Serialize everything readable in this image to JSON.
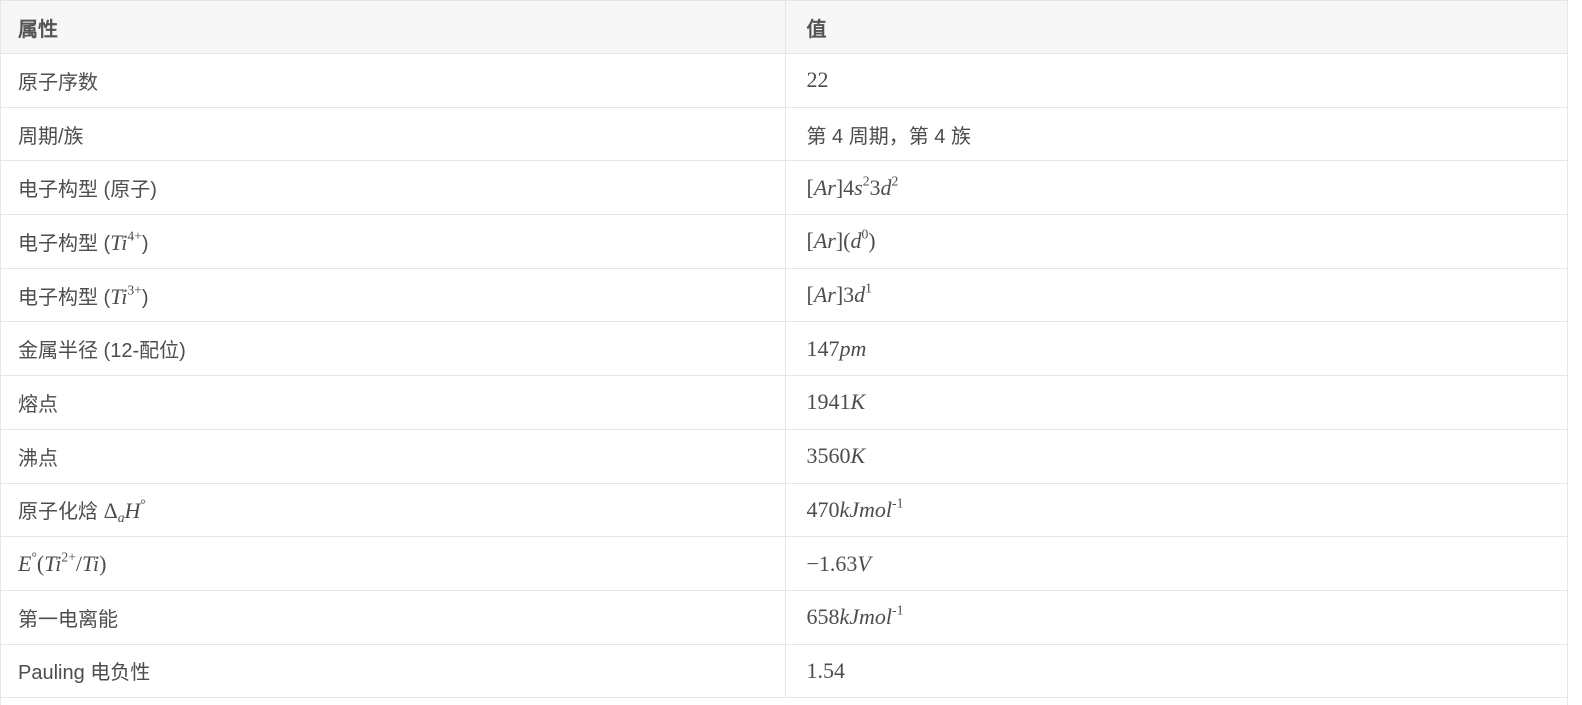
{
  "header": {
    "col_property": "属性",
    "col_value": "值"
  },
  "rows": [
    {
      "property": "原子序数",
      "value": "22"
    },
    {
      "property": "周期/族",
      "value": "第 4 周期，第 4 族"
    },
    {
      "property": "电子构型 (原子)",
      "value_parts": {
        "a": "[",
        "b": "Ar",
        "c": "]4",
        "d": "s",
        "e": "2",
        "f": "3",
        "g": "d",
        "h": "2"
      }
    },
    {
      "property_parts": {
        "prefix": "电子构型 (",
        "ti": "Ti",
        "sup": "4+",
        "suffix": ")"
      },
      "value_parts": {
        "a": "[",
        "b": "Ar",
        "c": "](",
        "d": "d",
        "e": "0",
        "f": ")"
      }
    },
    {
      "property_parts": {
        "prefix": "电子构型 (",
        "ti": "Ti",
        "sup": "3+",
        "suffix": ")"
      },
      "value_parts": {
        "a": "[",
        "b": "Ar",
        "c": "]3",
        "d": "d",
        "e": "1"
      }
    },
    {
      "property": "金属半径 (12-配位)",
      "value_parts": {
        "num": "147",
        "unit": "pm"
      }
    },
    {
      "property": "熔点",
      "value_parts": {
        "num": "1941",
        "unit": "K"
      }
    },
    {
      "property": "沸点",
      "value_parts": {
        "num": "3560",
        "unit": "K"
      }
    },
    {
      "property_parts": {
        "prefix": "原子化焓 ",
        "delta": "Δ",
        "sub": "a",
        "h": "H",
        "deg": "°"
      },
      "value_parts": {
        "num": "470",
        "unit": "kJmol",
        "sup": "-1"
      }
    },
    {
      "property_parts": {
        "e": "E",
        "deg": "°",
        "open": "(",
        "ti": "Ti",
        "sup": "2+",
        "slash": "/",
        "ti2": "Ti",
        "close": ")"
      },
      "value_parts": {
        "num": "−1.63",
        "unit": "V"
      }
    },
    {
      "property": "第一电离能",
      "value_parts": {
        "num": "658",
        "unit": "kJmol",
        "sup": "-1"
      }
    },
    {
      "property": "Pauling 电负性",
      "value": "1.54"
    }
  ]
}
